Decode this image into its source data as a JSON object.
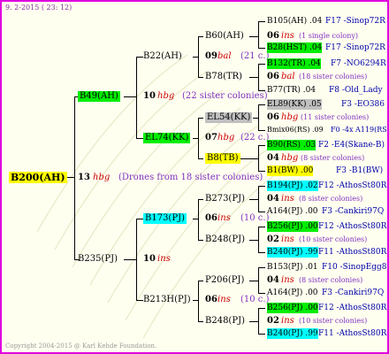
{
  "header": {
    "date": "9.  2-2015 ( 23: 12)"
  },
  "footer": {
    "copyright": "Copyright 2004-2015 @ Karl Kehde Foundation."
  },
  "root": {
    "id": "B200(AH)",
    "num": "13",
    "tag": "hbg",
    "note": "(Drones from 18 sister colonies)"
  },
  "l1": {
    "top": {
      "id": "B49(AH)",
      "num": "10",
      "tag": "hbg",
      "note": "(22 sister colonies)"
    },
    "bottom": {
      "id": "B235(PJ)",
      "num": "10",
      "tag": "ins"
    }
  },
  "l2": {
    "a": {
      "id": "B22(AH)",
      "num": "09",
      "tag": "bal",
      "note": "(21 c.)"
    },
    "b": {
      "id": "EL74(KK)",
      "num": "07",
      "tag": "hbg",
      "note": "(22 c.)"
    },
    "c": {
      "id": "B173(PJ)",
      "num": "06",
      "tag": "ins",
      "note": "(10 c.)"
    },
    "d": {
      "id": "B213H(PJ)",
      "num": "06",
      "tag": "ins",
      "note": "(10 c.)"
    }
  },
  "l3": {
    "a1": {
      "id": "B60(AH)",
      "num": "06",
      "tag": "ins",
      "note": "(1 single colony)"
    },
    "a2": {
      "id": "B78(TR)",
      "num": "06",
      "tag": "bal",
      "note": "(18 sister colonies)"
    },
    "b1": {
      "id": "EL54(KK)",
      "num": "06",
      "tag": "hbg",
      "note": "(11 sister colonies)"
    },
    "b2": {
      "id": "B8(TB)",
      "num": "04",
      "tag": "hbg",
      "note": "(8 sister colonies)"
    },
    "c1": {
      "id": "B273(PJ)",
      "num": "04",
      "tag": "ins",
      "note": "(8 sister colonies)"
    },
    "c2": {
      "id": "B248(PJ)",
      "num": "02",
      "tag": "ins",
      "note": "(10 sister colonies)"
    },
    "d1": {
      "id": "P206(PJ)",
      "num": "04",
      "tag": "ins",
      "note": "(8 sister colonies)"
    },
    "d2": {
      "id": "B248(PJ)",
      "num": "02",
      "tag": "ins",
      "note": "(10 sister colonies)"
    }
  },
  "l4": [
    {
      "left": "B105(AH) .04",
      "right": "F17 -Sinop72R"
    },
    {
      "left": "B28(HST) .04",
      "right": "F17 -Sinop72R"
    },
    {
      "left": "B132(TR) .04",
      "right": "F7 -NO6294R"
    },
    {
      "left": "B77(TR) .04",
      "right": "F8 -Old_Lady"
    },
    {
      "left": "EL89(KK) .05",
      "right": "F3 -EO386"
    },
    {
      "left": "Bmix06(RS) .09",
      "right": "F0 -4x A119(RS)"
    },
    {
      "left": "B90(RS) .03",
      "right": "F2 -E4(Skane-B)"
    },
    {
      "left": "B1(BW) .00",
      "right": "F3 -B1(BW)"
    },
    {
      "left": "B194(PJ) .02",
      "right": "F12 -AthosSt80R"
    },
    {
      "left": "A164(PJ) .00",
      "right": "F3 -Cankiri97Q"
    },
    {
      "left": "B256(PJ) .00",
      "right": "F12 -AthosSt80R"
    },
    {
      "left": "B240(PJ) .99",
      "right": "F11 -AthosSt80R"
    },
    {
      "left": "B153(PJ) .01",
      "right": "F10 -SinopEgg86R"
    },
    {
      "left": "A164(PJ) .00",
      "right": "F3 -Cankiri97Q"
    },
    {
      "left": "B256(PJ) .00",
      "right": "F12 -AthosSt80R"
    },
    {
      "left": "B240(PJ) .99",
      "right": "F11 -AthosSt80R"
    }
  ],
  "colors": {
    "frame": "#e000e0",
    "bg": "#fffff0",
    "yellow": "#ffff00",
    "green": "#00ee00",
    "cyan": "#00ffff",
    "gray": "#c0c0c0",
    "red": "#cc0000",
    "purple": "#8030c0",
    "blue": "#0000aa"
  }
}
